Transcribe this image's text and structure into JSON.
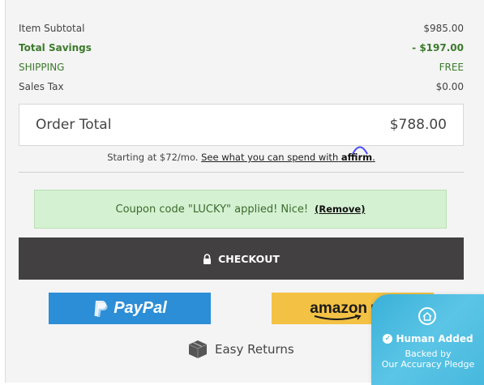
{
  "summary": {
    "subtotal_label": "Item Subtotal",
    "subtotal_value": "$985.00",
    "savings_label": "Total Savings",
    "savings_value": "- $197.00",
    "shipping_label": "SHIPPING",
    "shipping_value": "FREE",
    "tax_label": "Sales Tax",
    "tax_value": "$0.00"
  },
  "order_total": {
    "label": "Order Total",
    "value": "$788.00"
  },
  "affirm": {
    "prefix": "Starting at $72/mo.",
    "link_text": "See what you can spend with",
    "logo": "affirm",
    "suffix": "."
  },
  "coupon": {
    "message": "Coupon code \"LUCKY\" applied! Nice!",
    "remove_label": "(Remove)"
  },
  "checkout": {
    "label": "CHECKOUT",
    "icon": "lock-icon"
  },
  "payments": {
    "paypal_label": "PayPal",
    "amazon_label": "amazon",
    "amazon_pay_label": "pay"
  },
  "returns": {
    "label": "Easy Returns",
    "icon": "box-icon"
  },
  "badge": {
    "title": "Human Added",
    "line2": "Backed by",
    "line3": "Our Accuracy Pledge"
  },
  "colors": {
    "green": "#3c7a2c",
    "checkout_bg": "#424040",
    "paypal_blue": "#2c8ed6",
    "amazon_yellow": "#f3c144",
    "coupon_bg": "#d4f1d2",
    "badge_blue": "#46b8dd"
  }
}
